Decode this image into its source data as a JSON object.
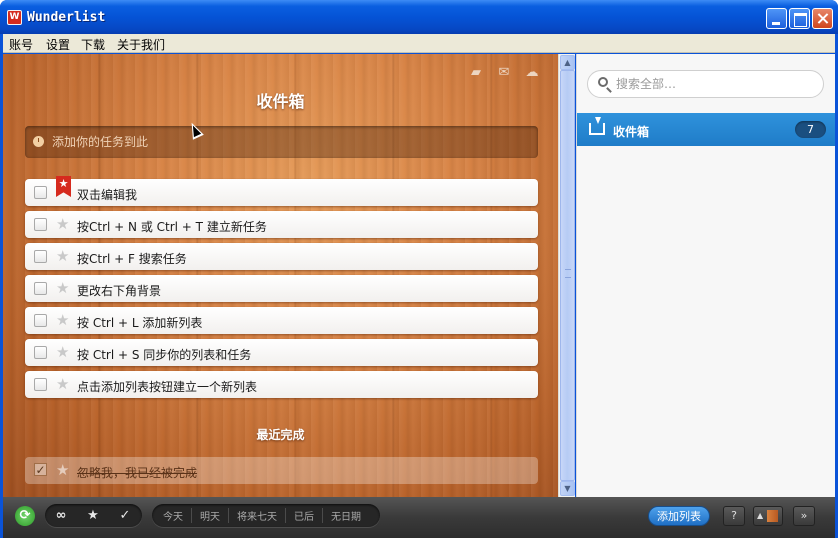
{
  "window": {
    "title": "Wunderlist",
    "logo_text": "W"
  },
  "menubar": {
    "items": [
      "账号",
      "设置",
      "下载",
      "关于我们"
    ]
  },
  "main": {
    "top_icons": [
      "print-icon",
      "mail-icon",
      "cloud-icon"
    ],
    "list_title": "收件箱",
    "add_task_placeholder": "添加你的任务到此",
    "tasks": [
      {
        "text": "双击编辑我",
        "starred": true
      },
      {
        "text": "按Ctrl + N 或 Ctrl + T 建立新任务",
        "starred": false
      },
      {
        "text": "按Ctrl + F 搜索任务",
        "starred": false
      },
      {
        "text": "更改右下角背景",
        "starred": false
      },
      {
        "text": "按 Ctrl + L 添加新列表",
        "starred": false
      },
      {
        "text": "按 Ctrl + S 同步你的列表和任务",
        "starred": false
      },
      {
        "text": "点击添加列表按钮建立一个新列表",
        "starred": false
      }
    ],
    "recent_done_title": "最近完成",
    "done_tasks": [
      {
        "text": "忽略我，我已经被完成"
      }
    ]
  },
  "sidebar": {
    "search_placeholder": "搜索全部…",
    "lists": [
      {
        "label": "收件箱",
        "count": "7"
      }
    ]
  },
  "bottombar": {
    "filters": [
      "∞",
      "★",
      "✓"
    ],
    "dates": [
      "今天",
      "明天",
      "将来七天",
      "已后",
      "无日期"
    ],
    "add_list_label": "添加列表",
    "help_label": "?",
    "collapse_label": "»"
  },
  "colors": {
    "accent": "#1f7cc8",
    "ribbon": "#d62a1e",
    "wood": "#d88446"
  }
}
